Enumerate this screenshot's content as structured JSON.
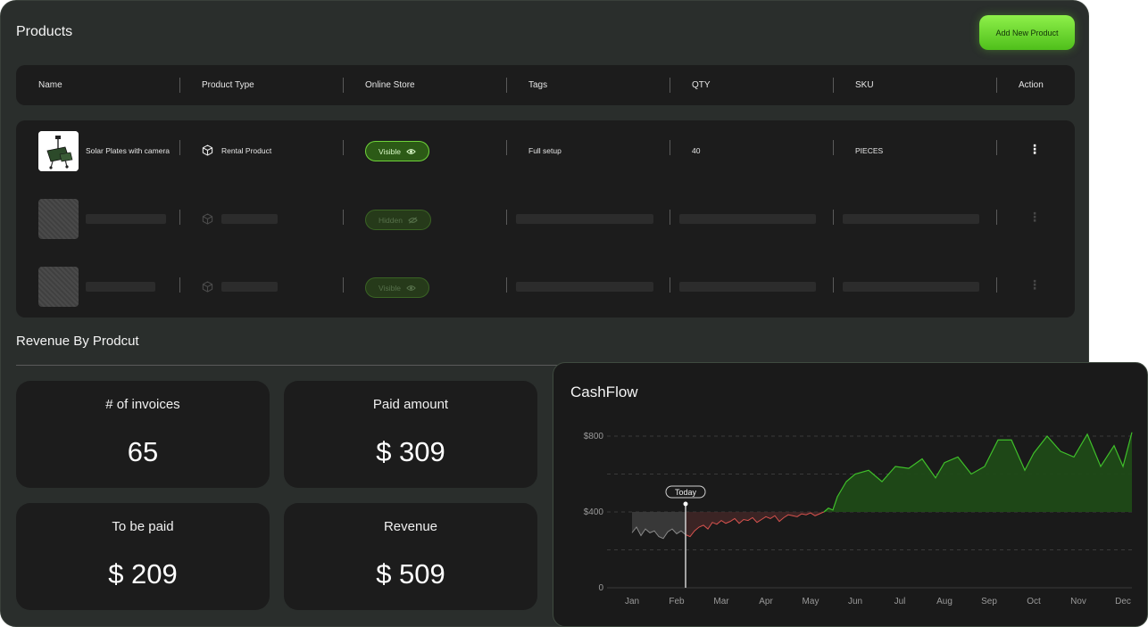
{
  "products_panel": {
    "title": "Products",
    "add_button": "Add New Product",
    "columns": [
      "Name",
      "Product Type",
      "Online Store",
      "Tags",
      "QTY",
      "SKU",
      "Action"
    ],
    "rows": [
      {
        "name": "Solar Plates with camera",
        "product_type": "Rental Product",
        "online_store": "Visible",
        "tags": "Full setup",
        "qty": "40",
        "sku": "PIECES"
      },
      {
        "online_store": "Hidden"
      },
      {
        "online_store": "Visible"
      }
    ]
  },
  "revenue": {
    "title": "Revenue By Prodcut",
    "stats": [
      {
        "label": "# of invoices",
        "value": "65"
      },
      {
        "label": "Paid amount",
        "value": "$ 309"
      },
      {
        "label": "To be paid",
        "value": "$ 209"
      },
      {
        "label": "Revenue",
        "value": "$ 509"
      }
    ]
  },
  "cashflow": {
    "title": "CashFlow",
    "today_label": "Today",
    "colors": {
      "positive": "#3fbf2a",
      "negative": "#d9534f",
      "past": "#8a8a8a"
    }
  },
  "chart_data": {
    "type": "area",
    "title": "CashFlow",
    "x_ticks": [
      "Jan",
      "Feb",
      "Mar",
      "Apr",
      "May",
      "Jun",
      "Jul",
      "Aug",
      "Sep",
      "Oct",
      "Nov",
      "Dec"
    ],
    "y_ticks": [
      "0",
      "$400",
      "$800"
    ],
    "ylim": [
      0,
      800
    ],
    "baseline": 400,
    "today_x": 1.2,
    "grid": "dashed",
    "series": [
      {
        "values_x": [
          0.0,
          0.1,
          0.2,
          0.3,
          0.4,
          0.5,
          0.6,
          0.7,
          0.8,
          0.9,
          1.0,
          1.1,
          1.2,
          1.3,
          1.4,
          1.5,
          1.6,
          1.7,
          1.8,
          1.9,
          2.0,
          2.1,
          2.2,
          2.3,
          2.4,
          2.5,
          2.6,
          2.7,
          2.8,
          2.9,
          3.0,
          3.1,
          3.2,
          3.3,
          3.4,
          3.5,
          3.6,
          3.7,
          3.8,
          3.9,
          4.0,
          4.1,
          4.2,
          4.3,
          4.4,
          4.5,
          4.6,
          4.7,
          4.8,
          5.0,
          5.3,
          5.6,
          5.9,
          6.2,
          6.5,
          6.8,
          7.0,
          7.3,
          7.6,
          7.9,
          8.2,
          8.5,
          8.8,
          9.0,
          9.3,
          9.6,
          9.9,
          10.2,
          10.5,
          10.8,
          11.0,
          11.2
        ],
        "values_y": [
          290,
          320,
          275,
          310,
          290,
          300,
          270,
          260,
          295,
          310,
          285,
          300,
          280,
          270,
          300,
          320,
          330,
          310,
          345,
          335,
          355,
          340,
          350,
          365,
          340,
          360,
          355,
          370,
          345,
          360,
          375,
          365,
          380,
          350,
          370,
          385,
          380,
          375,
          390,
          385,
          395,
          380,
          390,
          400,
          420,
          410,
          480,
          520,
          560,
          600,
          620,
          560,
          640,
          630,
          680,
          580,
          660,
          690,
          600,
          640,
          780,
          780,
          620,
          710,
          800,
          720,
          690,
          810,
          640,
          750,
          640,
          820
        ]
      }
    ]
  }
}
